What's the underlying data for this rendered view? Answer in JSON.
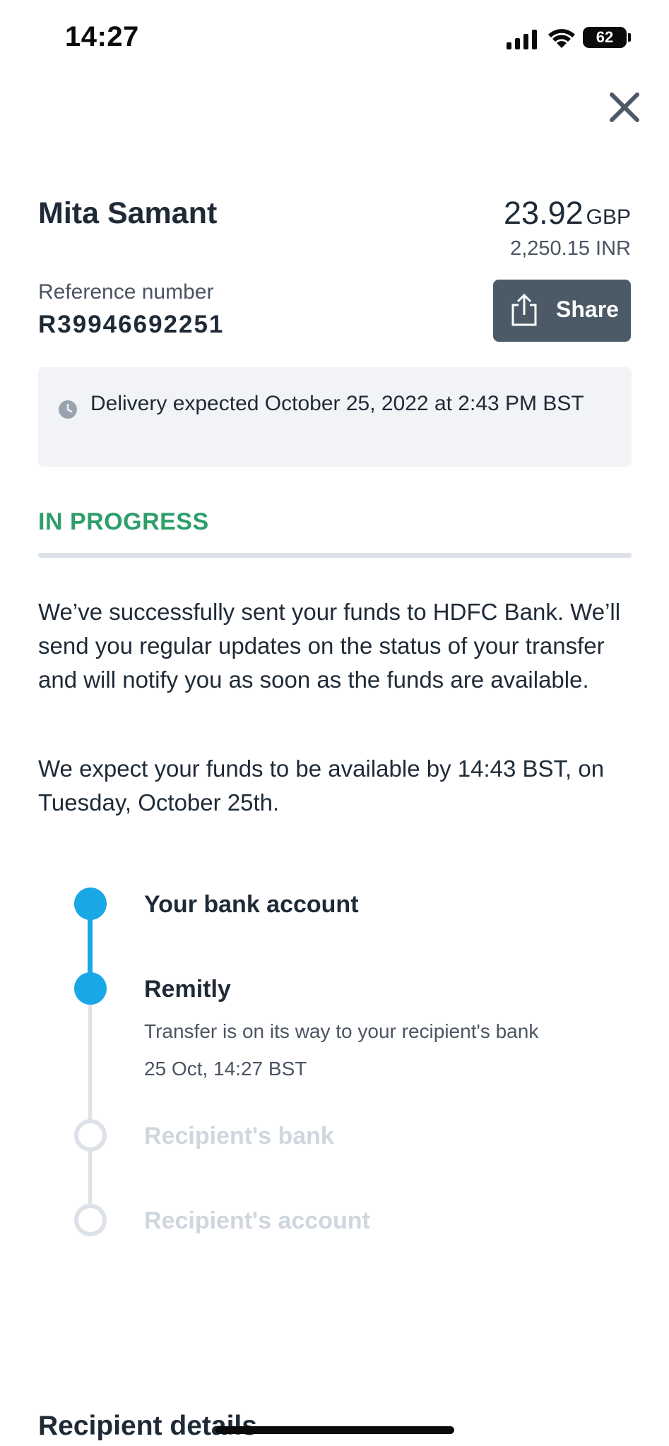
{
  "status_bar": {
    "time": "14:27",
    "battery": "62",
    "icons": [
      "signal-icon",
      "wifi-icon",
      "battery-icon"
    ]
  },
  "header": {
    "close_icon": "close-icon"
  },
  "transfer": {
    "recipient_name": "Mita Samant",
    "amount": "23.92",
    "currency": "GBP",
    "secondary_amount": "2,250.15 INR",
    "reference_label": "Reference number",
    "reference_number": "R39946692251",
    "share_label": "Share",
    "share_icon": "share-icon"
  },
  "delivery": {
    "icon": "clock-icon",
    "text": "Delivery expected October 25, 2022 at 2:43 PM BST"
  },
  "status": {
    "label": "IN PROGRESS",
    "color": "#2e9e6a",
    "paragraph_1": "We’ve successfully sent your funds to HDFC Bank. We’ll send you regular updates on the status of your transfer and will notify you as soon as the funds are available.",
    "paragraph_2": "We expect your funds to be available by 14:43 BST, on Tuesday, October 25th."
  },
  "timeline": {
    "accent": "#1aa7e6",
    "steps": [
      {
        "title": "Your bank account",
        "state": "done"
      },
      {
        "title": "Remitly",
        "state": "current",
        "subtitle": "Transfer is on its way to your recipient's bank",
        "timestamp": "25 Oct, 14:27 BST"
      },
      {
        "title": "Recipient's bank",
        "state": "pending"
      },
      {
        "title": "Recipient's account",
        "state": "pending"
      }
    ]
  },
  "sections": {
    "recipient_details": "Recipient details"
  }
}
